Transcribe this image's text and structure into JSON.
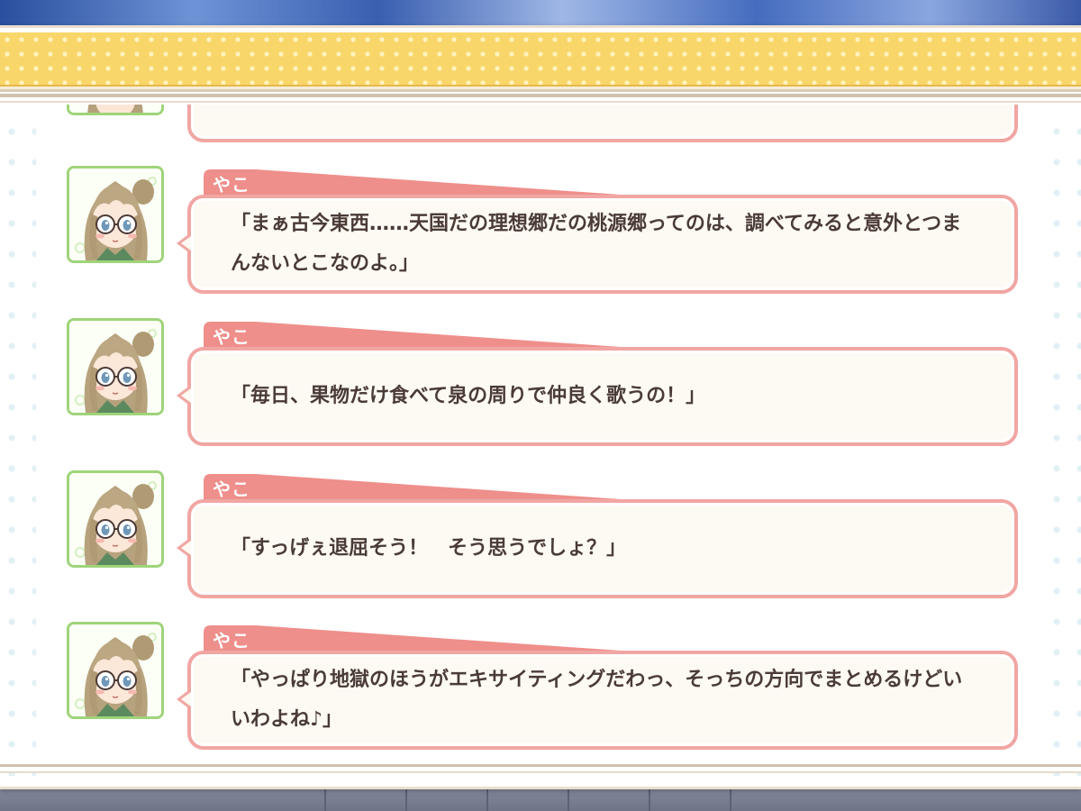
{
  "log": {
    "entries": [
      {
        "speaker": "やこ",
        "text": "「まぁ古今東西……天国だの理想郷だの桃源郷ってのは、調べてみると意外とつまんないとこなのよ。」"
      },
      {
        "speaker": "やこ",
        "text": "「毎日、果物だけ食べて泉の周りで仲良く歌うの！」"
      },
      {
        "speaker": "やこ",
        "text": "「すっげぇ退屈そう！　そう思うでしょ？」"
      },
      {
        "speaker": "やこ",
        "text": "「やっぱり地獄のほうがエキサイティングだわっ、そっちの方向でまとめるけどいいわよね♪」"
      }
    ]
  },
  "colors": {
    "name_tab": "#ee8f8b",
    "bubble_border": "#f1a6a3",
    "avatar_border": "#9fd47a",
    "header_bar": "#f8d66a",
    "text": "#4a3b36"
  },
  "icons": {
    "avatar": "character-portrait-icon"
  }
}
